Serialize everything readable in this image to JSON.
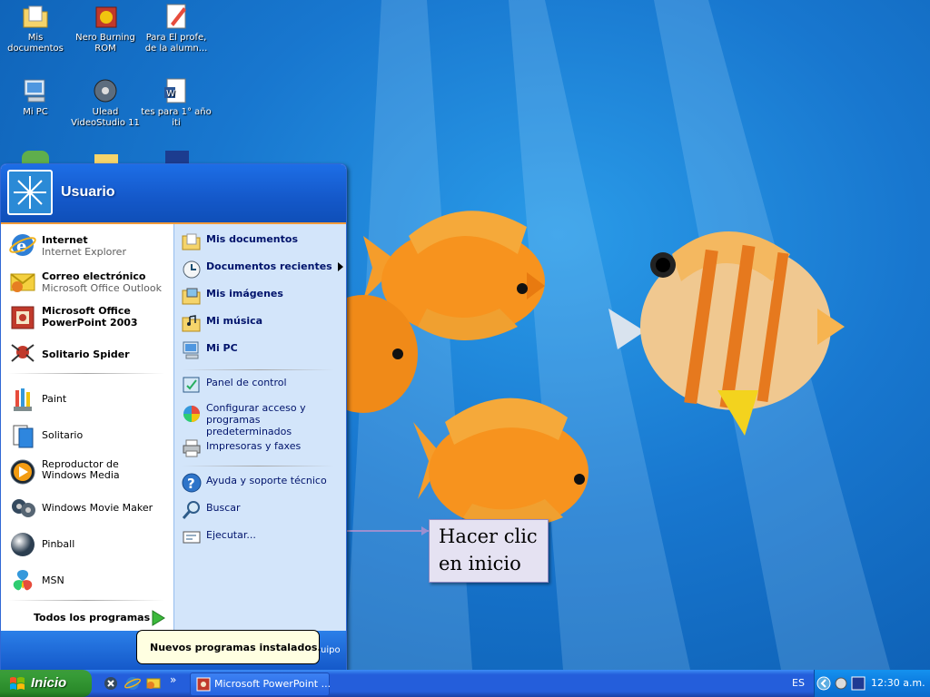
{
  "desktop": {
    "icons": [
      {
        "label": "Mis documentos",
        "icon": "folder-documents-icon"
      },
      {
        "label": "Nero Burning ROM",
        "icon": "nero-icon"
      },
      {
        "label": "Para El profe, de la alumn...",
        "icon": "paint-document-icon"
      },
      {
        "label": "Mi PC",
        "icon": "computer-icon"
      },
      {
        "label": "Ulead VideoStudio 11",
        "icon": "ulead-icon"
      },
      {
        "label": "tes para 1° año iti",
        "icon": "word-document-icon"
      }
    ]
  },
  "start_menu": {
    "user_name": "Usuario",
    "pinned": [
      {
        "title": "Internet",
        "subtitle": "Internet Explorer",
        "icon": "internet-explorer-icon"
      },
      {
        "title": "Correo electrónico",
        "subtitle": "Microsoft Office Outlook",
        "icon": "outlook-icon"
      },
      {
        "title": "Microsoft Office PowerPoint 2003",
        "icon": "powerpoint-icon"
      },
      {
        "title": "Solitario Spider",
        "icon": "spider-solitaire-icon"
      }
    ],
    "recent": [
      {
        "title": "Paint",
        "icon": "paint-icon"
      },
      {
        "title": "Solitario",
        "icon": "solitaire-icon"
      },
      {
        "title": "Reproductor de Windows Media",
        "icon": "media-player-icon"
      },
      {
        "title": "Windows Movie Maker",
        "icon": "movie-maker-icon"
      },
      {
        "title": "Pinball",
        "icon": "pinball-icon"
      },
      {
        "title": "MSN",
        "icon": "msn-icon"
      }
    ],
    "all_programs_label": "Todos los programas",
    "right": [
      {
        "title": "Mis documentos",
        "icon": "folder-documents-icon"
      },
      {
        "title": "Documentos recientes",
        "icon": "recent-documents-icon"
      },
      {
        "title": "Mis imágenes",
        "icon": "folder-pictures-icon"
      },
      {
        "title": "Mi música",
        "icon": "folder-music-icon"
      },
      {
        "title": "Mi PC",
        "icon": "computer-icon"
      },
      {
        "title": "Panel de control",
        "icon": "control-panel-icon"
      },
      {
        "title": "Configurar acceso y programas predeterminados",
        "icon": "default-programs-icon"
      },
      {
        "title": "Impresoras y faxes",
        "icon": "printer-icon"
      },
      {
        "title": "Ayuda y soporte técnico",
        "icon": "help-icon"
      },
      {
        "title": "Buscar",
        "icon": "search-icon"
      },
      {
        "title": "Ejecutar...",
        "icon": "run-icon"
      }
    ],
    "bottom_partial": "uipo"
  },
  "balloon": {
    "text": "Nuevos programas instalados."
  },
  "callout": {
    "text": "Hacer clic en inicio"
  },
  "taskbar": {
    "start_label": "Inicio",
    "task_item": "Microsoft PowerPoint ...",
    "quick_overflow": "»",
    "language": "ES",
    "clock": "12:30 a.m."
  },
  "colors": {
    "desktop_blue": "#1877cf",
    "start_green": "#379c37",
    "taskbar_blue": "#245edb",
    "accent_orange": "#f29b3a"
  }
}
